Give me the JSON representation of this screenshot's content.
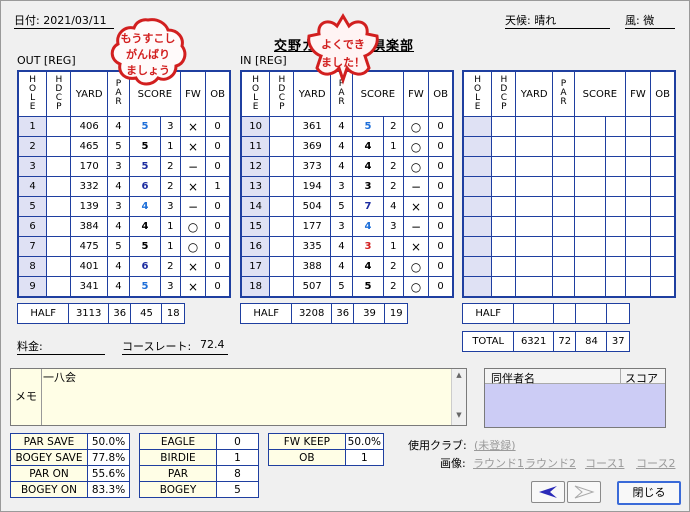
{
  "header": {
    "date_label": "日付: 2021/03/11",
    "weather_label": "天候: 晴れ",
    "wind_label": "風: 微",
    "course_title": "交野カントリー倶楽部"
  },
  "stamps": [
    {
      "text": "もうすこし\nがんばり\nましょう"
    },
    {
      "text": "よくでき\nました！"
    }
  ],
  "sections": {
    "out_label": "OUT [REG]",
    "in_label": "IN [REG]"
  },
  "columns": [
    "HOLE",
    "HDCP",
    "YARD",
    "PAR",
    "SCORE",
    "FW",
    "OB"
  ],
  "out_rows": [
    {
      "hole": "1",
      "yard": "406",
      "par": "4",
      "score": "5",
      "putt": "3",
      "fw": "×",
      "ob": "0",
      "color": "#1e6fd9"
    },
    {
      "hole": "2",
      "yard": "465",
      "par": "5",
      "score": "5",
      "putt": "1",
      "fw": "×",
      "ob": "0",
      "color": "#000000"
    },
    {
      "hole": "3",
      "yard": "170",
      "par": "3",
      "score": "5",
      "putt": "2",
      "fw": "−",
      "ob": "0",
      "color": "#1c2ca0"
    },
    {
      "hole": "4",
      "yard": "332",
      "par": "4",
      "score": "6",
      "putt": "2",
      "fw": "×",
      "ob": "1",
      "color": "#1c2ca0"
    },
    {
      "hole": "5",
      "yard": "139",
      "par": "3",
      "score": "4",
      "putt": "3",
      "fw": "−",
      "ob": "0",
      "color": "#1e6fd9"
    },
    {
      "hole": "6",
      "yard": "384",
      "par": "4",
      "score": "4",
      "putt": "1",
      "fw": "○",
      "ob": "0",
      "color": "#000000"
    },
    {
      "hole": "7",
      "yard": "475",
      "par": "5",
      "score": "5",
      "putt": "1",
      "fw": "○",
      "ob": "0",
      "color": "#000000"
    },
    {
      "hole": "8",
      "yard": "401",
      "par": "4",
      "score": "6",
      "putt": "2",
      "fw": "×",
      "ob": "0",
      "color": "#1c2ca0"
    },
    {
      "hole": "9",
      "yard": "341",
      "par": "4",
      "score": "5",
      "putt": "3",
      "fw": "×",
      "ob": "0",
      "color": "#1e6fd9"
    }
  ],
  "in_rows": [
    {
      "hole": "10",
      "yard": "361",
      "par": "4",
      "score": "5",
      "putt": "2",
      "fw": "○",
      "ob": "0",
      "color": "#1e6fd9"
    },
    {
      "hole": "11",
      "yard": "369",
      "par": "4",
      "score": "4",
      "putt": "1",
      "fw": "○",
      "ob": "0",
      "color": "#000000"
    },
    {
      "hole": "12",
      "yard": "373",
      "par": "4",
      "score": "4",
      "putt": "2",
      "fw": "○",
      "ob": "0",
      "color": "#000000"
    },
    {
      "hole": "13",
      "yard": "194",
      "par": "3",
      "score": "3",
      "putt": "2",
      "fw": "−",
      "ob": "0",
      "color": "#000000"
    },
    {
      "hole": "14",
      "yard": "504",
      "par": "5",
      "score": "7",
      "putt": "4",
      "fw": "×",
      "ob": "0",
      "color": "#1c2ca0"
    },
    {
      "hole": "15",
      "yard": "177",
      "par": "3",
      "score": "4",
      "putt": "3",
      "fw": "−",
      "ob": "0",
      "color": "#1e6fd9"
    },
    {
      "hole": "16",
      "yard": "335",
      "par": "4",
      "score": "3",
      "putt": "1",
      "fw": "×",
      "ob": "0",
      "color": "#d21f1f"
    },
    {
      "hole": "17",
      "yard": "388",
      "par": "4",
      "score": "4",
      "putt": "2",
      "fw": "○",
      "ob": "0",
      "color": "#000000"
    },
    {
      "hole": "18",
      "yard": "507",
      "par": "5",
      "score": "5",
      "putt": "2",
      "fw": "○",
      "ob": "0",
      "color": "#000000"
    }
  ],
  "out_half": {
    "label": "HALF",
    "yard": "3113",
    "par": "36",
    "score": "45",
    "putt": "18"
  },
  "in_half": {
    "label": "HALF",
    "yard": "3208",
    "par": "36",
    "score": "39",
    "putt": "19"
  },
  "total": {
    "label": "TOTAL",
    "yard": "6321",
    "par": "72",
    "score": "84",
    "putt": "37"
  },
  "fee_label": "料金:",
  "course_rate_label": "コースレート:",
  "course_rate_value": "72.4",
  "memo": {
    "label": "メモ",
    "text": "一八会"
  },
  "companions": {
    "name_header": "同伴者名",
    "score_header": "スコア"
  },
  "stats_left": [
    {
      "k": "PAR SAVE",
      "v": "50.0%"
    },
    {
      "k": "BOGEY SAVE",
      "v": "77.8%"
    },
    {
      "k": "PAR ON",
      "v": "55.6%"
    },
    {
      "k": "BOGEY ON",
      "v": "83.3%"
    }
  ],
  "stats_mid": [
    {
      "k": "EAGLE",
      "v": "0"
    },
    {
      "k": "BIRDIE",
      "v": "1"
    },
    {
      "k": "PAR",
      "v": "8"
    },
    {
      "k": "BOGEY",
      "v": "5"
    }
  ],
  "stats_right": [
    {
      "k": "FW KEEP",
      "v": "50.0%"
    },
    {
      "k": "OB",
      "v": "1"
    }
  ],
  "clubs_label": "使用クラブ:",
  "clubs_value": "(未登録)",
  "images_label": "画像:",
  "image_links": [
    "ラウンド1",
    "ラウンド2",
    "コース1",
    "コース2"
  ],
  "buttons": {
    "close": "閉じる"
  },
  "colors": {
    "border": "#1f3fa0",
    "hole_bg": "#dfe1f4",
    "memo_bg": "#fffee6",
    "companion_bg": "#ccccf5"
  }
}
